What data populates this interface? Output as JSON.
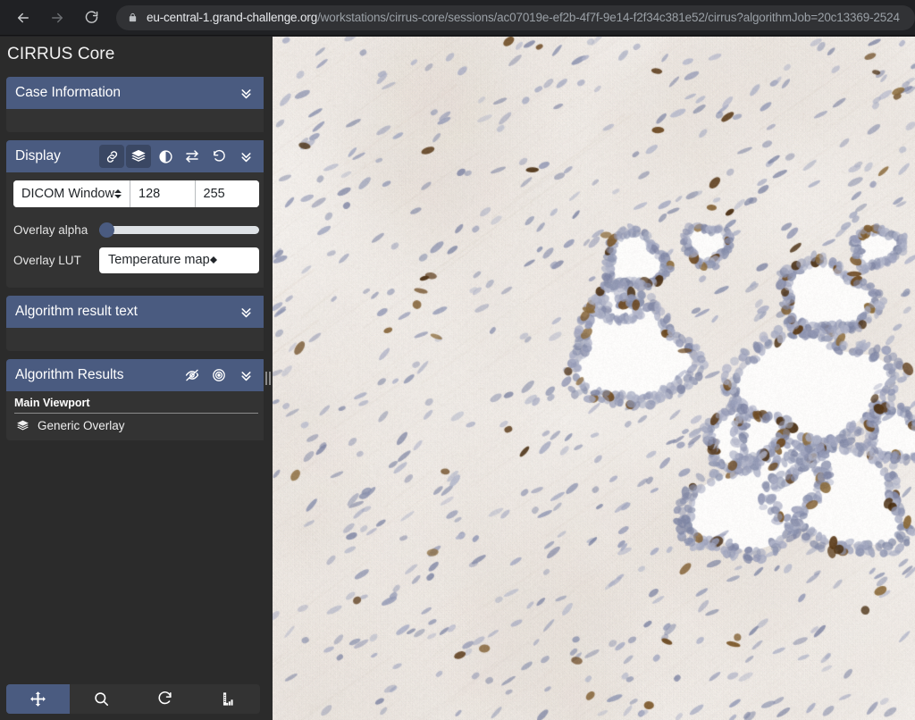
{
  "browser": {
    "back_icon": "arrow-left-icon",
    "forward_icon": "arrow-right-icon",
    "reload_icon": "reload-icon",
    "lock_icon": "lock-icon",
    "url_host": "eu-central-1.grand-challenge.org",
    "url_path": "/workstations/cirrus-core/sessions/ac07019e-ef2b-4f7f-9e14-f2f34c381e52/cirrus?algorithmJob=20c13369-2524",
    "url_full": "eu-central-1.grand-challenge.org/workstations/cirrus-core/sessions/ac07019e-ef2b-4f7f-9e14-f2f34c381e52/cirrus?algorithmJob=20c13369-2524"
  },
  "app": {
    "title": "CIRRUS Core"
  },
  "panels": {
    "case_information": {
      "title": "Case Information",
      "collapse_icon": "chevron-double-down-icon"
    },
    "display": {
      "title": "Display",
      "icons": [
        {
          "name": "link-icon",
          "active": true
        },
        {
          "name": "layers-icon",
          "active": true
        },
        {
          "name": "contrast-icon",
          "active": false
        },
        {
          "name": "swap-arrows-icon",
          "active": false
        },
        {
          "name": "reset-icon",
          "active": false
        },
        {
          "name": "chevron-double-down-icon",
          "active": false
        }
      ],
      "window_preset": "DICOM Window",
      "window_center": "128",
      "window_width": "255",
      "overlay_alpha_label": "Overlay alpha",
      "overlay_alpha_value": 0,
      "overlay_lut_label": "Overlay LUT",
      "overlay_lut_value": "Temperature map"
    },
    "algorithm_result_text": {
      "title": "Algorithm result text",
      "collapse_icon": "chevron-double-down-icon"
    },
    "algorithm_results": {
      "title": "Algorithm Results",
      "icons": [
        {
          "name": "eye-slash-icon",
          "active": false
        },
        {
          "name": "target-icon",
          "active": false
        },
        {
          "name": "chevron-double-down-icon",
          "active": false
        }
      ],
      "viewport_group": "Main Viewport",
      "overlays": [
        {
          "label": "Generic Overlay",
          "icon": "layers-icon"
        }
      ]
    }
  },
  "toolbar": {
    "tools": [
      {
        "name": "pan-tool",
        "icon": "move-arrows-icon",
        "active": true
      },
      {
        "name": "zoom-tool",
        "icon": "magnifier-icon",
        "active": false
      },
      {
        "name": "rotate-tool",
        "icon": "rotate-cw-icon",
        "active": false
      },
      {
        "name": "measure-tool",
        "icon": "ruler-icon",
        "active": false
      }
    ]
  },
  "splitter": {
    "name": "panel-splitter",
    "icon": "grip-vertical-icon"
  },
  "viewport": {
    "name": "main-viewport",
    "content": "immunohistochemistry-whole-slide-image",
    "description": "IHC stained tissue: pale stroma with diagonal fibers, blue-purple nuclei, brown DAB-positive cells, white glandular lumina"
  },
  "colors": {
    "panel_header": "#4a5b80",
    "panel_body": "#333333",
    "app_background": "#2b2b2b",
    "chrome_background": "#202124",
    "omnibox_background": "#313235",
    "accent_active": "#4a5b80",
    "text_primary": "#ffffff",
    "url_host_text": "#e8eaed",
    "url_path_text": "#9aa0a6"
  }
}
